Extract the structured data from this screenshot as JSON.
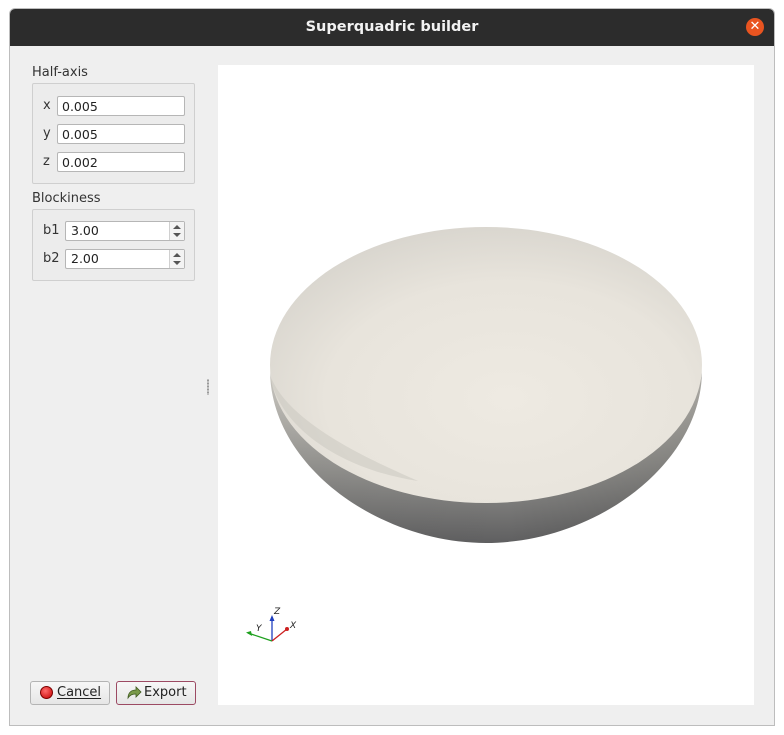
{
  "window": {
    "title": "Superquadric builder",
    "close_icon": "close-icon"
  },
  "half_axis": {
    "label": "Half-axis",
    "x_label": "x",
    "x_value": "0.005",
    "y_label": "y",
    "y_value": "0.005",
    "z_label": "z",
    "z_value": "0.002"
  },
  "blockiness": {
    "label": "Blockiness",
    "b1_label": "b1",
    "b1_value": "3.00",
    "b2_label": "b2",
    "b2_value": "2.00"
  },
  "viewport": {
    "axes": {
      "x": "X",
      "y": "Y",
      "z": "Z"
    },
    "shape_color": "#ece8e0"
  },
  "buttons": {
    "cancel_label": "Cancel",
    "cancel_icon": "red-circle-icon",
    "export_label": "Export",
    "export_icon": "export-arrow-icon"
  }
}
